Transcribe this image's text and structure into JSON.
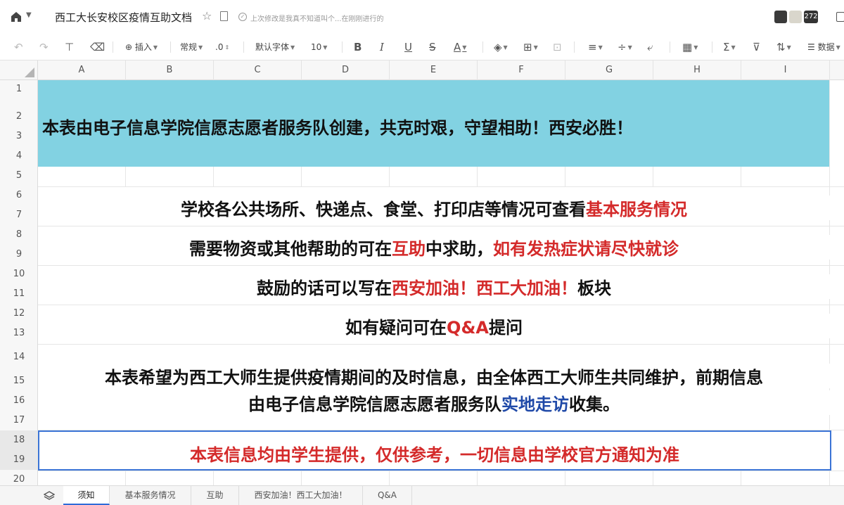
{
  "titlebar": {
    "doc_title": "西工大长安校区疫情互助文档",
    "save_status": "上次修改是我真不知道叫个...在刚刚进行的",
    "collaborator_count": "272"
  },
  "toolbar": {
    "insert": "插入",
    "format": "常规",
    "decimal": ".0",
    "font": "默认字体",
    "size": "10",
    "data": "数据"
  },
  "columns": [
    "A",
    "B",
    "C",
    "D",
    "E",
    "F",
    "G",
    "H",
    "I"
  ],
  "rows": [
    "1",
    "2",
    "3",
    "4",
    "5",
    "6",
    "7",
    "8",
    "9",
    "10",
    "11",
    "12",
    "13",
    "14",
    "15",
    "16",
    "17",
    "18",
    "19",
    "20"
  ],
  "content": {
    "banner": "本表由电子信息学院信愿志愿者服务队创建，共克时艰，守望相助！西安必胜！",
    "line1_a": "学校各公共场所、快递点、食堂、打印店等情况可查看",
    "line1_b": "基本服务情况",
    "line2_a": "需要物资或其他帮助的可在",
    "line2_b": "互助",
    "line2_c": "中求助，",
    "line2_d": "如有发热症状请尽快就诊",
    "line3_a": "鼓励的话可以写在",
    "line3_b": "西安加油！西工大加油！",
    "line3_c": "板块",
    "line4_a": "如有疑问可在",
    "line4_b": "Q&A",
    "line4_c": "提问",
    "line5": "本表希望为西工大师生提供疫情期间的及时信息，由全体西工大师生共同维护，前期信息",
    "line6_a": "由电子信息学院信愿志愿者服务队",
    "line6_b": "实地走访",
    "line6_c": "收集。",
    "notice": "本表信息均由学生提供，仅供参考，一切信息由学校官方通知为准"
  },
  "tabs": [
    "须知",
    "基本服务情况",
    "互助",
    "西安加油！西工大加油！",
    "Q&A"
  ],
  "colors": {
    "banner": "#82d2e2",
    "red": "#d42a2a",
    "blue": "#1f49a8",
    "selection": "#3b74d6"
  }
}
